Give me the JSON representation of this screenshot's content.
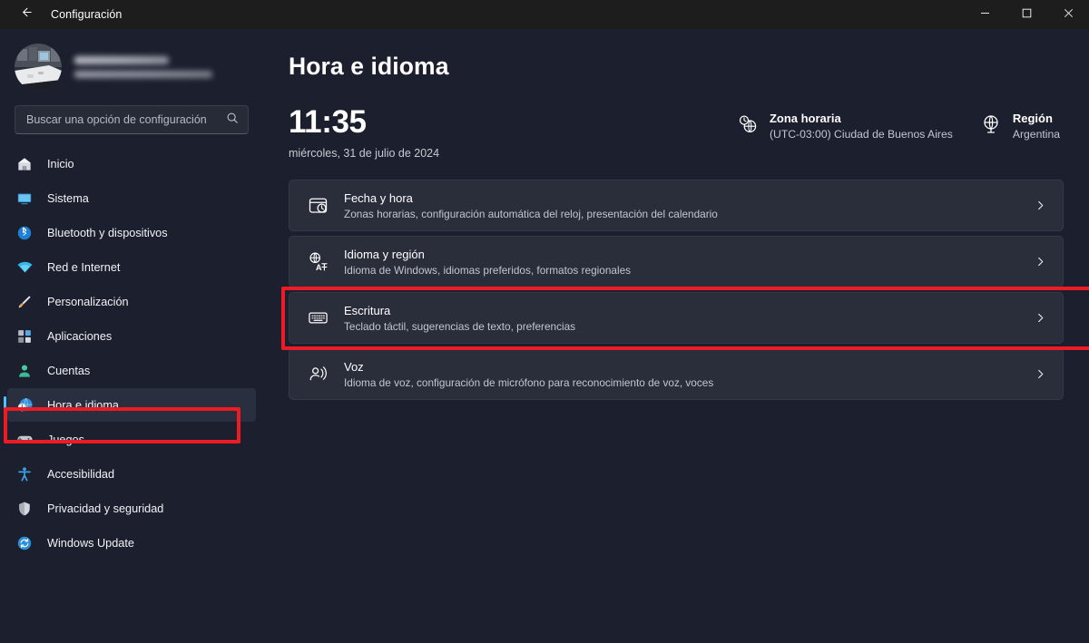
{
  "window": {
    "app_title": "Configuración",
    "back_icon": "back-arrow-icon",
    "minimize_label": "—",
    "maximize_label": "□",
    "close_label": "✕"
  },
  "sidebar": {
    "account": {
      "name_redacted": "",
      "email_redacted": "",
      "avatar_icon": "user-avatar-photo"
    },
    "search": {
      "placeholder": "Buscar una opción de configuración",
      "value": "",
      "icon": "search-icon"
    },
    "items": [
      {
        "label": "Inicio",
        "icon": "home-icon",
        "active": false
      },
      {
        "label": "Sistema",
        "icon": "system-icon",
        "active": false
      },
      {
        "label": "Bluetooth y dispositivos",
        "icon": "bluetooth-icon",
        "active": false
      },
      {
        "label": "Red e Internet",
        "icon": "wifi-icon",
        "active": false
      },
      {
        "label": "Personalización",
        "icon": "brush-icon",
        "active": false
      },
      {
        "label": "Aplicaciones",
        "icon": "apps-icon",
        "active": false
      },
      {
        "label": "Cuentas",
        "icon": "account-icon",
        "active": false
      },
      {
        "label": "Hora e idioma",
        "icon": "clock-globe-icon",
        "active": true
      },
      {
        "label": "Juegos",
        "icon": "gamepad-icon",
        "active": false
      },
      {
        "label": "Accesibilidad",
        "icon": "accessibility-icon",
        "active": false
      },
      {
        "label": "Privacidad y seguridad",
        "icon": "shield-icon",
        "active": false
      },
      {
        "label": "Windows Update",
        "icon": "update-icon",
        "active": false
      }
    ]
  },
  "main": {
    "page_title": "Hora e idioma",
    "clock": {
      "time": "11:35",
      "date": "miércoles, 31 de julio de 2024"
    },
    "meta": [
      {
        "title": "Zona horaria",
        "subtitle": "(UTC-03:00) Ciudad de Buenos Aires",
        "icon": "timezone-globe-clock-icon"
      },
      {
        "title": "Región",
        "subtitle": "Argentina",
        "icon": "region-globe-icon"
      }
    ],
    "cards": [
      {
        "title": "Fecha y hora",
        "subtitle": "Zonas horarias, configuración automática del reloj, presentación del calendario",
        "icon": "calendar-clock-icon",
        "chevron": "chevron-right-icon"
      },
      {
        "title": "Idioma y región",
        "subtitle": "Idioma de Windows, idiomas preferidos, formatos regionales",
        "icon": "translate-icon",
        "chevron": "chevron-right-icon"
      },
      {
        "title": "Escritura",
        "subtitle": "Teclado táctil, sugerencias de texto, preferencias",
        "icon": "keyboard-icon",
        "chevron": "chevron-right-icon"
      },
      {
        "title": "Voz",
        "subtitle": "Idioma de voz, configuración de micrófono para reconocimiento de voz, voces",
        "icon": "speech-icon",
        "chevron": "chevron-right-icon"
      }
    ]
  },
  "annotations": {
    "highlight_color": "#ed1c24",
    "targets": [
      "Hora e idioma",
      "Escritura"
    ]
  },
  "colors": {
    "accent": "#4cc2ff",
    "page_background": "#1b1f2e",
    "card_background": "#2a2e3b",
    "titlebar_background": "#1d1d1d",
    "highlight": "#ed1c24"
  }
}
